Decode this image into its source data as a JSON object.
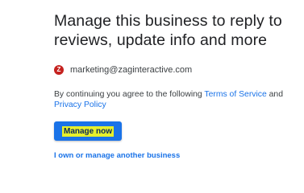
{
  "heading": "Manage this business to reply to reviews, update info and more",
  "account": {
    "avatar_letter": "Z",
    "email": "marketing@zaginteractive.com"
  },
  "terms": {
    "prefix": "By continuing you agree to the following ",
    "terms_link": "Terms of Service",
    "middle": " and ",
    "privacy_link": "Privacy Policy"
  },
  "manage_button": "Manage now",
  "other_business_link": "I own or manage another business",
  "colors": {
    "primary_blue": "#1a73e8",
    "avatar_red": "#c5221f",
    "highlight_yellow": "#e6ef2c"
  }
}
